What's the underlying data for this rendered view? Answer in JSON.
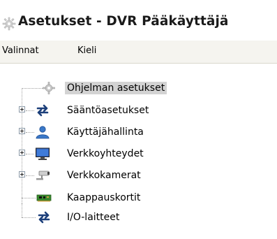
{
  "window": {
    "title": "Asetukset - DVR Pääkäyttäjä",
    "icon": "gear-icon"
  },
  "menu": {
    "items": [
      "Valinnat",
      "Kieli"
    ]
  },
  "tree": {
    "items": [
      {
        "label": "Ohjelman asetukset",
        "icon": "gear-icon",
        "expandable": false,
        "selected": true
      },
      {
        "label": "Sääntöasetukset",
        "icon": "arrows-icon",
        "expandable": true,
        "selected": false
      },
      {
        "label": "Käyttäjähallinta",
        "icon": "user-icon",
        "expandable": true,
        "selected": false
      },
      {
        "label": "Verkkoyhteydet",
        "icon": "monitor-icon",
        "expandable": true,
        "selected": false
      },
      {
        "label": "Verkkokamerat",
        "icon": "camera-icon",
        "expandable": true,
        "selected": false
      },
      {
        "label": "Kaappauskortit",
        "icon": "capture-card-icon",
        "expandable": false,
        "selected": false
      },
      {
        "label": "I/O-laitteet",
        "icon": "arrows-icon",
        "expandable": false,
        "selected": false
      }
    ]
  },
  "colors": {
    "selection": "#d3d3d3",
    "menubar": "#f5f4ef",
    "user_icon": "#3a78c8",
    "monitor_icon": "#2f5fb8",
    "capture_card_icon": "#3b8a2e"
  }
}
